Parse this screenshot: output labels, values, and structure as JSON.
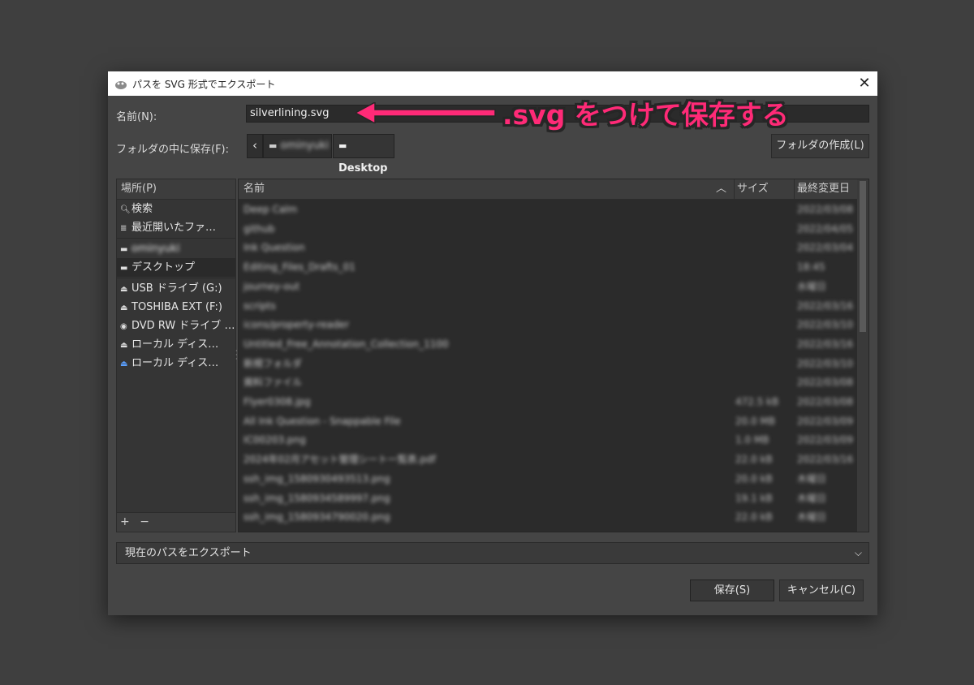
{
  "window": {
    "title": "パスを SVG 形式でエクスポート",
    "close_glyph": "✕"
  },
  "name_field": {
    "label": "名前(N):",
    "value": "silverlining.svg"
  },
  "annotation": {
    "text": ".svg をつけて保存する",
    "color": "#ff2a77"
  },
  "folder_row": {
    "label": "フォルダの中に保存(F):",
    "back_glyph": "‹",
    "crumbs": [
      "ominyuki",
      "Desktop"
    ],
    "create_folder_label": "フォルダの作成(L)"
  },
  "places": {
    "header": "場所(P)",
    "items": [
      {
        "label": "検索",
        "icon": "search-icon"
      },
      {
        "label": "最近開いたファ…",
        "icon": "recent-icon"
      },
      {
        "label": "ominyuki",
        "icon": "folder-icon",
        "blurred": true
      },
      {
        "label": "デスクトップ",
        "icon": "folder-icon",
        "selected": true
      },
      {
        "label": "USB ドライブ (G:)",
        "icon": "drive-icon"
      },
      {
        "label": "TOSHIBA EXT (F:)",
        "icon": "drive-icon"
      },
      {
        "label": "DVD RW ドライブ …",
        "icon": "dvd-icon"
      },
      {
        "label": "ローカル ディス…",
        "icon": "drive-icon"
      },
      {
        "label": "ローカル ディス…",
        "icon": "windows-drive-icon"
      }
    ],
    "footer": {
      "add": "+",
      "remove": "−"
    }
  },
  "files": {
    "columns": {
      "name": "名前",
      "size": "サイズ",
      "modified": "最終変更日"
    },
    "rows": [
      {
        "name": "Deep Calm",
        "size": "",
        "date": "2022/03/08"
      },
      {
        "name": "github",
        "size": "",
        "date": "2022/04/05"
      },
      {
        "name": "Ink Question",
        "size": "",
        "date": "2022/03/04"
      },
      {
        "name": "Editing_Files_Drafts_01",
        "size": "",
        "date": "18:45"
      },
      {
        "name": "journey-out",
        "size": "",
        "date": "水曜日"
      },
      {
        "name": "scripts",
        "size": "",
        "date": "2022/03/16"
      },
      {
        "name": "icons/property-reader",
        "size": "",
        "date": "2022/03/10"
      },
      {
        "name": "Untitled_Free_Annotation_Collection_1100",
        "size": "",
        "date": "2022/03/16"
      },
      {
        "name": "新規フォルダ",
        "size": "",
        "date": "2022/03/10"
      },
      {
        "name": "資料ファイル",
        "size": "",
        "date": "2022/03/08"
      },
      {
        "name": "Flyer0308.jpg",
        "size": "472.5 kB",
        "date": "2022/03/08"
      },
      {
        "name": "All Ink Question - Snappable File",
        "size": "20.0 MB",
        "date": "2022/03/09"
      },
      {
        "name": "IC00203.png",
        "size": "1.0 MB",
        "date": "2022/03/09"
      },
      {
        "name": "2024年02月アセット管理シート一覧表.pdf",
        "size": "22.0 kB",
        "date": "2022/03/16"
      },
      {
        "name": "ssh_img_1580930493513.png",
        "size": "20.0 kB",
        "date": "木曜日"
      },
      {
        "name": "ssh_img_1580934589997.png",
        "size": "19.1 kB",
        "date": "木曜日"
      },
      {
        "name": "ssh_img_1580934790020.png",
        "size": "22.0 kB",
        "date": "木曜日"
      }
    ]
  },
  "export_select": {
    "value": "現在のパスをエクスポート",
    "chevron": "⌵"
  },
  "buttons": {
    "save": "保存(S)",
    "cancel": "キャンセル(C)"
  }
}
